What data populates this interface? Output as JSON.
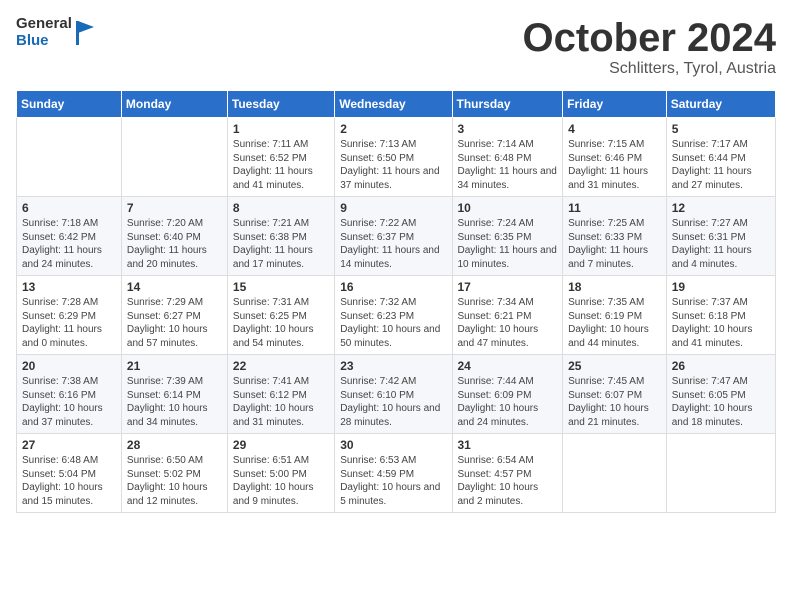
{
  "header": {
    "logo_general": "General",
    "logo_blue": "Blue",
    "month_title": "October 2024",
    "location": "Schlitters, Tyrol, Austria"
  },
  "weekdays": [
    "Sunday",
    "Monday",
    "Tuesday",
    "Wednesday",
    "Thursday",
    "Friday",
    "Saturday"
  ],
  "weeks": [
    [
      {
        "day": "",
        "content": ""
      },
      {
        "day": "",
        "content": ""
      },
      {
        "day": "1",
        "content": "Sunrise: 7:11 AM\nSunset: 6:52 PM\nDaylight: 11 hours and 41 minutes."
      },
      {
        "day": "2",
        "content": "Sunrise: 7:13 AM\nSunset: 6:50 PM\nDaylight: 11 hours and 37 minutes."
      },
      {
        "day": "3",
        "content": "Sunrise: 7:14 AM\nSunset: 6:48 PM\nDaylight: 11 hours and 34 minutes."
      },
      {
        "day": "4",
        "content": "Sunrise: 7:15 AM\nSunset: 6:46 PM\nDaylight: 11 hours and 31 minutes."
      },
      {
        "day": "5",
        "content": "Sunrise: 7:17 AM\nSunset: 6:44 PM\nDaylight: 11 hours and 27 minutes."
      }
    ],
    [
      {
        "day": "6",
        "content": "Sunrise: 7:18 AM\nSunset: 6:42 PM\nDaylight: 11 hours and 24 minutes."
      },
      {
        "day": "7",
        "content": "Sunrise: 7:20 AM\nSunset: 6:40 PM\nDaylight: 11 hours and 20 minutes."
      },
      {
        "day": "8",
        "content": "Sunrise: 7:21 AM\nSunset: 6:38 PM\nDaylight: 11 hours and 17 minutes."
      },
      {
        "day": "9",
        "content": "Sunrise: 7:22 AM\nSunset: 6:37 PM\nDaylight: 11 hours and 14 minutes."
      },
      {
        "day": "10",
        "content": "Sunrise: 7:24 AM\nSunset: 6:35 PM\nDaylight: 11 hours and 10 minutes."
      },
      {
        "day": "11",
        "content": "Sunrise: 7:25 AM\nSunset: 6:33 PM\nDaylight: 11 hours and 7 minutes."
      },
      {
        "day": "12",
        "content": "Sunrise: 7:27 AM\nSunset: 6:31 PM\nDaylight: 11 hours and 4 minutes."
      }
    ],
    [
      {
        "day": "13",
        "content": "Sunrise: 7:28 AM\nSunset: 6:29 PM\nDaylight: 11 hours and 0 minutes."
      },
      {
        "day": "14",
        "content": "Sunrise: 7:29 AM\nSunset: 6:27 PM\nDaylight: 10 hours and 57 minutes."
      },
      {
        "day": "15",
        "content": "Sunrise: 7:31 AM\nSunset: 6:25 PM\nDaylight: 10 hours and 54 minutes."
      },
      {
        "day": "16",
        "content": "Sunrise: 7:32 AM\nSunset: 6:23 PM\nDaylight: 10 hours and 50 minutes."
      },
      {
        "day": "17",
        "content": "Sunrise: 7:34 AM\nSunset: 6:21 PM\nDaylight: 10 hours and 47 minutes."
      },
      {
        "day": "18",
        "content": "Sunrise: 7:35 AM\nSunset: 6:19 PM\nDaylight: 10 hours and 44 minutes."
      },
      {
        "day": "19",
        "content": "Sunrise: 7:37 AM\nSunset: 6:18 PM\nDaylight: 10 hours and 41 minutes."
      }
    ],
    [
      {
        "day": "20",
        "content": "Sunrise: 7:38 AM\nSunset: 6:16 PM\nDaylight: 10 hours and 37 minutes."
      },
      {
        "day": "21",
        "content": "Sunrise: 7:39 AM\nSunset: 6:14 PM\nDaylight: 10 hours and 34 minutes."
      },
      {
        "day": "22",
        "content": "Sunrise: 7:41 AM\nSunset: 6:12 PM\nDaylight: 10 hours and 31 minutes."
      },
      {
        "day": "23",
        "content": "Sunrise: 7:42 AM\nSunset: 6:10 PM\nDaylight: 10 hours and 28 minutes."
      },
      {
        "day": "24",
        "content": "Sunrise: 7:44 AM\nSunset: 6:09 PM\nDaylight: 10 hours and 24 minutes."
      },
      {
        "day": "25",
        "content": "Sunrise: 7:45 AM\nSunset: 6:07 PM\nDaylight: 10 hours and 21 minutes."
      },
      {
        "day": "26",
        "content": "Sunrise: 7:47 AM\nSunset: 6:05 PM\nDaylight: 10 hours and 18 minutes."
      }
    ],
    [
      {
        "day": "27",
        "content": "Sunrise: 6:48 AM\nSunset: 5:04 PM\nDaylight: 10 hours and 15 minutes."
      },
      {
        "day": "28",
        "content": "Sunrise: 6:50 AM\nSunset: 5:02 PM\nDaylight: 10 hours and 12 minutes."
      },
      {
        "day": "29",
        "content": "Sunrise: 6:51 AM\nSunset: 5:00 PM\nDaylight: 10 hours and 9 minutes."
      },
      {
        "day": "30",
        "content": "Sunrise: 6:53 AM\nSunset: 4:59 PM\nDaylight: 10 hours and 5 minutes."
      },
      {
        "day": "31",
        "content": "Sunrise: 6:54 AM\nSunset: 4:57 PM\nDaylight: 10 hours and 2 minutes."
      },
      {
        "day": "",
        "content": ""
      },
      {
        "day": "",
        "content": ""
      }
    ]
  ]
}
